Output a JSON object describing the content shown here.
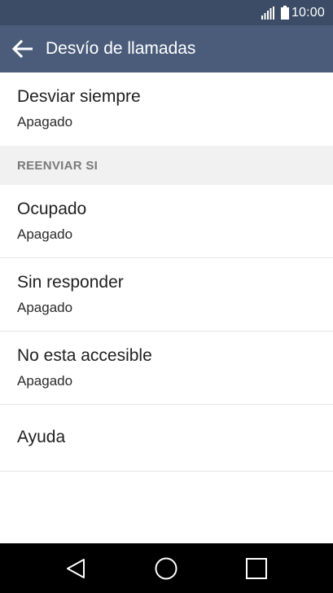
{
  "status_bar": {
    "time": "10:00",
    "signal_icon": "signal-bars-icon",
    "battery_icon": "battery-icon"
  },
  "app_bar": {
    "back_icon": "arrow-back-icon",
    "title": "Desvío de llamadas"
  },
  "items_top": [
    {
      "title": "Desviar siempre",
      "subtitle": "Apagado"
    }
  ],
  "section": {
    "header": "REENVIAR SI"
  },
  "items": [
    {
      "title": "Ocupado",
      "subtitle": "Apagado"
    },
    {
      "title": "Sin responder",
      "subtitle": "Apagado"
    },
    {
      "title": "No esta accesible",
      "subtitle": "Apagado"
    }
  ],
  "help": {
    "title": "Ayuda"
  },
  "nav_bar": {
    "back_icon": "nav-back-triangle-icon",
    "home_icon": "nav-home-circle-icon",
    "recents_icon": "nav-recents-square-icon"
  },
  "colors": {
    "status_bar": "#3c4b66",
    "app_bar": "#4a5c7a",
    "section_bg": "#f1f1f1",
    "nav_bar": "#000000"
  }
}
